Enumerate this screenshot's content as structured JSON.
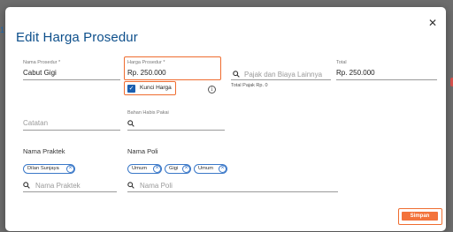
{
  "backdrop": {
    "left_glyph": "1"
  },
  "modal": {
    "title": "Edit Harga Prosedur",
    "close_icon": "close-icon"
  },
  "nama_prosedur": {
    "label": "Nama Prosedur *",
    "value": "Cabut Gigi"
  },
  "harga_prosedur": {
    "label": "Harga Prosedur *",
    "value": "Rp. 250.000",
    "highlight_color": "#ef6c2f"
  },
  "kunci_harga": {
    "label": "Kunci Harga",
    "checked": true,
    "info_icon": "info-icon"
  },
  "pajak": {
    "placeholder": "Pajak dan Biaya Lainnya",
    "total_text": "Total Pajak Rp. 0"
  },
  "total": {
    "label": "Total",
    "value": "Rp. 250.000"
  },
  "catatan": {
    "placeholder": "Catatan"
  },
  "bahan_habis_pakai": {
    "label": "Bahan Habis Pakai"
  },
  "nama_praktek": {
    "section_label": "Nama Praktek",
    "chips": [
      "Dilan Sunjaya"
    ],
    "placeholder": "Nama Praktek"
  },
  "nama_poli": {
    "section_label": "Nama Poli",
    "chips": [
      "Umum",
      "Gigi",
      "Umum"
    ],
    "placeholder": "Nama Poli"
  },
  "actions": {
    "save_label": "Simpan",
    "accent": "#f3733b"
  }
}
